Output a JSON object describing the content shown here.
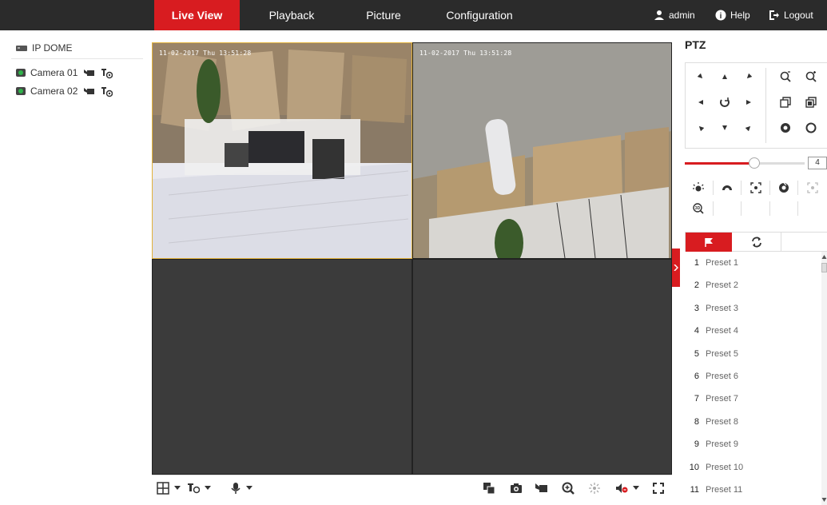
{
  "nav": {
    "tabs": [
      {
        "label": "Live View"
      },
      {
        "label": "Playback"
      },
      {
        "label": "Picture"
      },
      {
        "label": "Configuration"
      }
    ],
    "user": "admin",
    "help": "Help",
    "logout": "Logout"
  },
  "tree": {
    "root": "IP DOME",
    "cameras": [
      {
        "label": "Camera 01"
      },
      {
        "label": "Camera 02"
      }
    ]
  },
  "video": {
    "panes": [
      {
        "osd": "11-02-2017 Thu 13:51:28"
      },
      {
        "osd": "11-02-2017 Thu 13:51:28"
      }
    ]
  },
  "ptz": {
    "title": "PTZ",
    "speed": "4"
  },
  "presets": [
    {
      "num": "1",
      "name": "Preset 1"
    },
    {
      "num": "2",
      "name": "Preset 2"
    },
    {
      "num": "3",
      "name": "Preset 3"
    },
    {
      "num": "4",
      "name": "Preset 4"
    },
    {
      "num": "5",
      "name": "Preset 5"
    },
    {
      "num": "6",
      "name": "Preset 6"
    },
    {
      "num": "7",
      "name": "Preset 7"
    },
    {
      "num": "8",
      "name": "Preset 8"
    },
    {
      "num": "9",
      "name": "Preset 9"
    },
    {
      "num": "10",
      "name": "Preset 10"
    },
    {
      "num": "11",
      "name": "Preset 11"
    }
  ],
  "colors": {
    "accent": "#d81c20",
    "topbar": "#2b2b2b",
    "selected_pane": "#e2b23a"
  }
}
